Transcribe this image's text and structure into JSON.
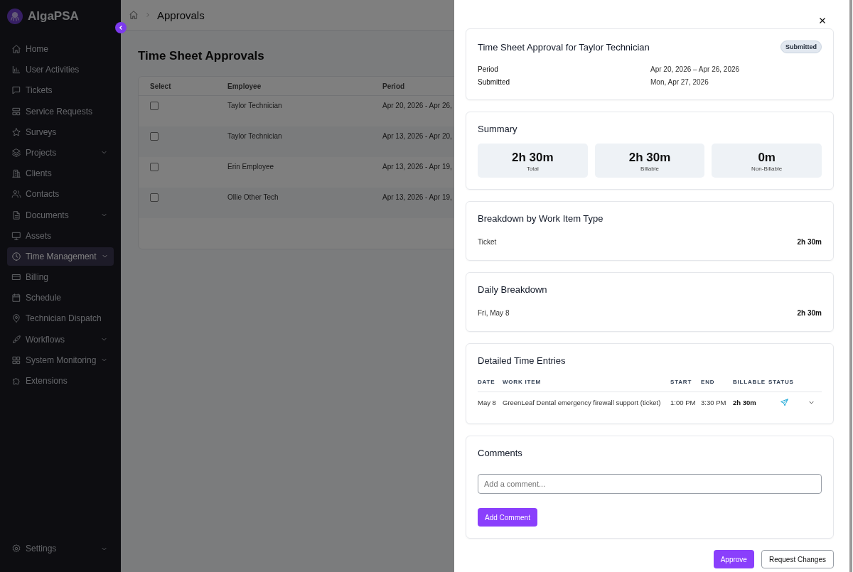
{
  "sidebar": {
    "brand": "AlgaPSA",
    "items": [
      {
        "label": "Home",
        "expandable": false,
        "selected": false
      },
      {
        "label": "User Activities",
        "expandable": false,
        "selected": false
      },
      {
        "label": "Tickets",
        "expandable": false,
        "selected": false
      },
      {
        "label": "Service Requests",
        "expandable": false,
        "selected": false
      },
      {
        "label": "Surveys",
        "expandable": false,
        "selected": false
      },
      {
        "label": "Projects",
        "expandable": true,
        "selected": false
      },
      {
        "label": "Clients",
        "expandable": false,
        "selected": false
      },
      {
        "label": "Contacts",
        "expandable": false,
        "selected": false
      },
      {
        "label": "Documents",
        "expandable": true,
        "selected": false
      },
      {
        "label": "Assets",
        "expandable": false,
        "selected": false
      },
      {
        "label": "Time Management",
        "expandable": true,
        "selected": true
      },
      {
        "label": "Billing",
        "expandable": false,
        "selected": false
      },
      {
        "label": "Schedule",
        "expandable": false,
        "selected": false
      },
      {
        "label": "Technician Dispatch",
        "expandable": false,
        "selected": false
      },
      {
        "label": "Workflows",
        "expandable": true,
        "selected": false
      },
      {
        "label": "System Monitoring",
        "expandable": true,
        "selected": false
      },
      {
        "label": "Extensions",
        "expandable": false,
        "selected": false
      }
    ],
    "settings": {
      "label": "Settings",
      "expandable": true
    }
  },
  "breadcrumb": {
    "current": "Approvals"
  },
  "page": {
    "title": "Time Sheet Approvals",
    "table": {
      "columns": [
        "Select",
        "Employee",
        "Period"
      ],
      "rows": [
        {
          "checked": false,
          "employee": "Taylor Technician",
          "period": "Apr 20, 2026 - Apr 26,"
        },
        {
          "checked": false,
          "employee": "Taylor Technician",
          "period": "Apr 13, 2026 - Apr 20,"
        },
        {
          "checked": false,
          "employee": "Erin Employee",
          "period": "Apr 13, 2026 - Apr 19,"
        },
        {
          "checked": false,
          "employee": "Ollie Other Tech",
          "period": "Apr 13, 2026 - Apr 19,"
        }
      ]
    }
  },
  "drawer": {
    "header": {
      "title": "Time Sheet Approval for Taylor Technician",
      "status": "Submitted",
      "fields": [
        {
          "label": "Period",
          "value": "Apr 20, 2026 – Apr 26, 2026"
        },
        {
          "label": "Submitted",
          "value": "Mon, Apr 27, 2026"
        }
      ]
    },
    "summary": {
      "title": "Summary",
      "stats": [
        {
          "value": "2h 30m",
          "label": "Total"
        },
        {
          "value": "2h 30m",
          "label": "Billable"
        },
        {
          "value": "0m",
          "label": "Non-Billable"
        }
      ]
    },
    "breakdown": {
      "title": "Breakdown by Work Item Type",
      "rows": [
        {
          "label": "Ticket",
          "value": "2h 30m"
        }
      ]
    },
    "daily": {
      "title": "Daily Breakdown",
      "rows": [
        {
          "label": "Fri, May 8",
          "value": "2h 30m"
        }
      ]
    },
    "entries": {
      "title": "Detailed Time Entries",
      "columns": [
        "DATE",
        "WORK ITEM",
        "START",
        "END",
        "BILLABLE",
        "STATUS"
      ],
      "rows": [
        {
          "date": "May 8",
          "work_item": "GreenLeaf Dental emergency firewall support (ticket)",
          "start": "1:00 PM",
          "end": "3:30 PM",
          "billable": "2h 30m",
          "expanded": false
        }
      ]
    },
    "comments": {
      "title": "Comments",
      "placeholder": "Add a comment...",
      "button": "Add Comment"
    },
    "actions": [
      {
        "label": "Approve",
        "primary": true
      },
      {
        "label": "Request Changes",
        "primary": false
      }
    ]
  }
}
